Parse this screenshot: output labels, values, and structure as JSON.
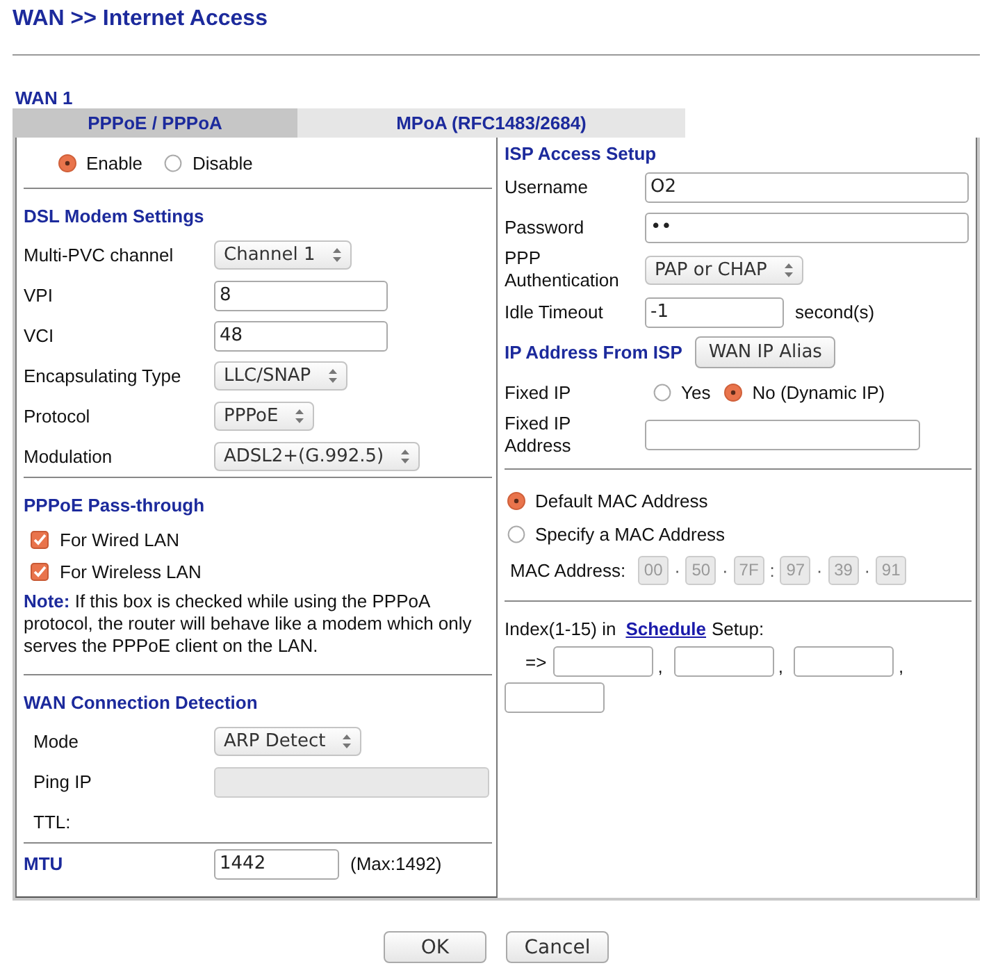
{
  "page_title": "WAN >> Internet Access",
  "wan_label": "WAN 1",
  "tabs": [
    {
      "label": "PPPoE / PPPoA",
      "selected": true
    },
    {
      "label": "MPoA (RFC1483/2684)",
      "selected": false
    }
  ],
  "enable_options": [
    {
      "label": "Enable",
      "selected": true
    },
    {
      "label": "Disable",
      "selected": false
    }
  ],
  "dsl_modem_settings": {
    "heading": "DSL Modem Settings",
    "fields": [
      {
        "label": "Multi-PVC channel",
        "kind": "select",
        "value": "Channel 1"
      },
      {
        "label": "VPI",
        "kind": "input",
        "value": "8"
      },
      {
        "label": "VCI",
        "kind": "input",
        "value": "48"
      },
      {
        "label": "Encapsulating Type",
        "kind": "select",
        "value": "LLC/SNAP"
      },
      {
        "label": "Protocol",
        "kind": "select",
        "value": "PPPoE"
      },
      {
        "label": "Modulation",
        "kind": "select",
        "value": "ADSL2+(G.992.5)"
      }
    ]
  },
  "pppoe_pass_through": {
    "heading": "PPPoE Pass-through",
    "options": [
      {
        "label": "For Wired LAN",
        "checked": true
      },
      {
        "label": "For Wireless LAN",
        "checked": true
      }
    ],
    "note": "**Note:** If this box is checked while using the PPPoA protocol, the router will behave like a modem which only serves the PPPoE client on the LAN."
  },
  "wan_connection_detection": {
    "heading": "WAN Connection Detection",
    "fields": [
      {
        "label": "Mode",
        "kind": "select",
        "value": "ARP Detect"
      },
      {
        "label": "Ping IP",
        "kind": "input",
        "disabled": true
      },
      {
        "label": "TTL:",
        "kind": "label"
      }
    ]
  },
  "mtu": {
    "label": "MTU",
    "value": "1442",
    "hint": "(Max:1492)"
  },
  "isp_access_setup": {
    "heading": "ISP Access Setup",
    "fields": [
      {
        "label": "Username",
        "kind": "input",
        "value": "O2"
      },
      {
        "label": "Password",
        "kind": "input",
        "value": "••"
      },
      {
        "label": "PPP Authentication",
        "kind": "select",
        "value": "PAP or CHAP"
      },
      {
        "label": "Idle Timeout",
        "kind": "input",
        "value": "-1",
        "unit": "second(s)"
      }
    ]
  },
  "ip_address_from_isp": {
    "heading": "IP Address From ISP",
    "alias_button": "WAN IP Alias",
    "fixed_ip": {
      "label": "Fixed IP",
      "options": [
        {
          "label": "Yes",
          "selected": false
        },
        {
          "label": "No (Dynamic IP)",
          "selected": true
        }
      ]
    },
    "fixed_ip_address": {
      "label": "Fixed IP Address"
    }
  },
  "mac": {
    "options": [
      {
        "label": "Default MAC Address",
        "selected": true
      },
      {
        "label": "Specify a MAC Address",
        "selected": false
      }
    ],
    "label": "MAC Address:",
    "disabled": true,
    "octets": [
      {
        "value": "00"
      },
      {
        "sep": "·",
        "value": "50"
      },
      {
        "sep": "·",
        "value": "7F"
      },
      {
        "sep": ":",
        "value": "97"
      },
      {
        "sep": "·",
        "value": "39"
      },
      {
        "sep": "·",
        "value": "91"
      }
    ]
  },
  "schedule": {
    "prefix": "Index(1-15) in",
    "link": "Schedule",
    "suffix": "Setup:",
    "arrow": "=>",
    "slots": [
      {
        "kind": "field",
        "comma": ","
      },
      {
        "kind": "field",
        "comma": ","
      },
      {
        "kind": "field",
        "comma": ","
      },
      {
        "kind": "field"
      }
    ]
  },
  "buttons": [
    "OK",
    "Cancel"
  ]
}
